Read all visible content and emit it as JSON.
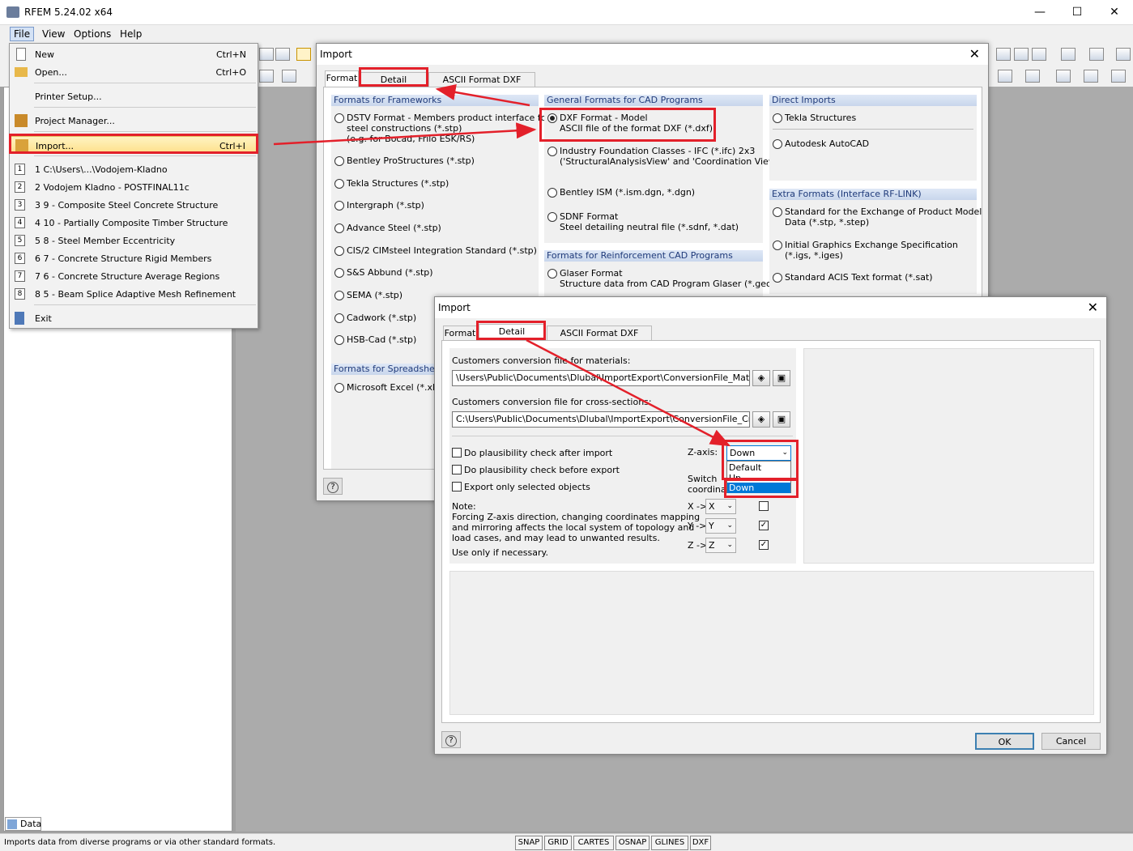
{
  "app": {
    "title": "RFEM 5.24.02 x64"
  },
  "menubar": {
    "file": "File",
    "view": "View",
    "options": "Options",
    "help": "Help"
  },
  "file_menu": {
    "new": "New",
    "new_key": "Ctrl+N",
    "open": "Open...",
    "open_key": "Ctrl+O",
    "printer": "Printer Setup...",
    "project": "Project Manager...",
    "import": "Import...",
    "import_key": "Ctrl+I",
    "recent": [
      {
        "n": "1",
        "label": "1 C:\\Users\\...\\Vodojem-Kladno"
      },
      {
        "n": "2",
        "label": "2 Vodojem Kladno - POSTFINAL11c"
      },
      {
        "n": "3",
        "label": "3 9 - Composite Steel Concrete Structure"
      },
      {
        "n": "4",
        "label": "4 10 - Partially Composite Timber Structure"
      },
      {
        "n": "5",
        "label": "5 8 - Steel Member Eccentricity"
      },
      {
        "n": "6",
        "label": "6 7 - Concrete Structure Rigid Members"
      },
      {
        "n": "7",
        "label": "7 6 - Concrete Structure Average Regions"
      },
      {
        "n": "8",
        "label": "8 5 - Beam Splice Adaptive Mesh Refinement"
      }
    ],
    "exit": "Exit"
  },
  "sidepane": {
    "data_tab": "Data"
  },
  "statusbar": {
    "text": "Imports data from diverse programs or via other standard formats.",
    "buttons": [
      "SNAP",
      "GRID",
      "CARTES",
      "OSNAP",
      "GLINES",
      "DXF"
    ]
  },
  "import1": {
    "title": "Import",
    "tabs": [
      "Format",
      "Detail Settings",
      "ASCII Format DXF (*.dxf)"
    ],
    "frameworks": {
      "head": "Formats for Frameworks",
      "items": [
        "DSTV Format - Members product interface for",
        "steel constructions (*.stp)",
        "(e.g. for Bocad, Frilo ESK/RS)",
        "Bentley ProStructures (*.stp)",
        "Tekla Structures (*.stp)",
        "Intergraph (*.stp)",
        "Advance Steel (*.stp)",
        "CIS/2 CIMsteel Integration Standard (*.stp)",
        "S&S Abbund (*.stp)",
        "SEMA (*.stp)",
        "Cadwork (*.stp)",
        "HSB-Cad (*.stp)"
      ]
    },
    "spreadsheets": {
      "head": "Formats for Spreadsheets",
      "item": "Microsoft Excel (*.xls)"
    },
    "cad": {
      "head": "General Formats for CAD Programs",
      "dxf1": "DXF Format - Model",
      "dxf2": "ASCII file of the format DXF (*.dxf)",
      "ifc1": "Industry Foundation Classes - IFC (*.ifc) 2x3",
      "ifc2": "('StructuralAnalysisView' and 'Coordination View')",
      "ism": "Bentley ISM (*.ism.dgn, *.dgn)",
      "sdnf1": "SDNF Format",
      "sdnf2": "Steel detailing neutral file (*.sdnf, *.dat)"
    },
    "reinf": {
      "head": "Formats for Reinforcement CAD Programs",
      "g1": "Glaser Format",
      "g2": "Structure data from CAD Program Glaser (*.geo)"
    },
    "direct": {
      "head": "Direct Imports",
      "tekla": "Tekla Structures",
      "acad": "Autodesk AutoCAD"
    },
    "extra": {
      "head": "Extra Formats (Interface RF-LINK)",
      "s1": "Standard for the Exchange of Product Model",
      "s2": "Data (*.stp, *.step)",
      "i1": "Initial Graphics Exchange Specification",
      "i2": "(*.igs, *.iges)",
      "acis": "Standard ACIS Text format (*.sat)"
    }
  },
  "import2": {
    "title": "Import",
    "tabs": [
      "Format",
      "Detail Settings",
      "ASCII Format DXF (*.dxf)"
    ],
    "mat_label": "Customers conversion file for materials:",
    "mat_value": "\\Users\\Public\\Documents\\Dlubal\\ImportExport\\ConversionFile_Material.txt",
    "cs_label": "Customers conversion file for cross-sections:",
    "cs_value": "C:\\Users\\Public\\Documents\\Dlubal\\ImportExport\\ConversionFile_CrossSect",
    "chk1": "Do plausibility check after import",
    "chk2": "Do plausibility check before export",
    "chk3": "Export only selected objects",
    "note_head": "Note:",
    "note1": "Forcing Z-axis direction, changing coordinates mapping",
    "note2": "and mirroring affects the local system of topology and",
    "note3": "load cases, and may lead to unwanted results.",
    "note4": "Use only if necessary.",
    "zaxis_label": "Z-axis:",
    "zaxis_value": "Down",
    "zaxis_options": [
      "Default",
      "Up",
      "Down"
    ],
    "switch1": "Switch",
    "switch2": "coordinates",
    "map": [
      {
        "lbl": "X ->",
        "val": "X",
        "mirror": false
      },
      {
        "lbl": "Y ->",
        "val": "Y",
        "mirror": true
      },
      {
        "lbl": "Z ->",
        "val": "Z",
        "mirror": true
      }
    ],
    "ok": "OK",
    "cancel": "Cancel"
  },
  "colors": {
    "annotation": "#e3202a",
    "highlight": "#0078d7"
  }
}
